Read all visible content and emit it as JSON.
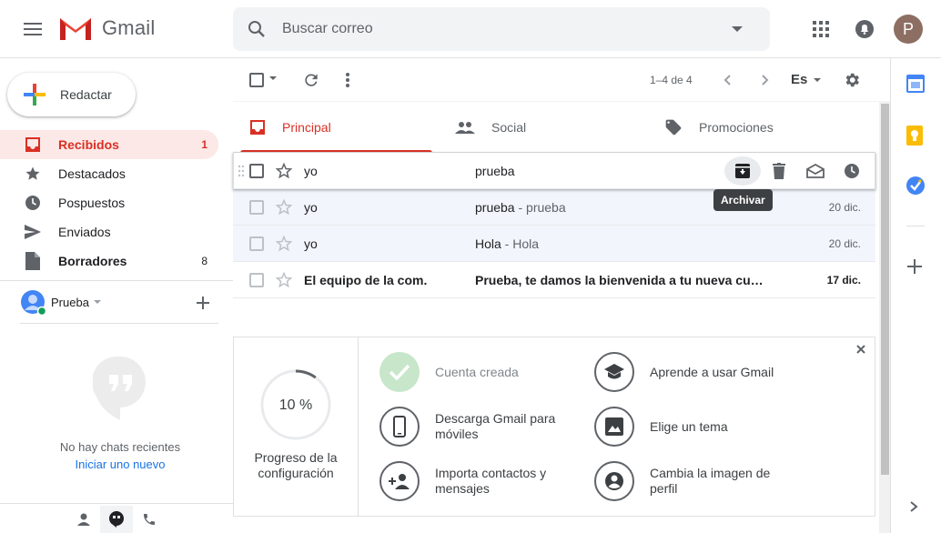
{
  "header": {
    "app_name": "Gmail",
    "search_placeholder": "Buscar correo",
    "avatar_letter": "P"
  },
  "sidebar": {
    "compose_label": "Redactar",
    "items": [
      {
        "label": "Recibidos",
        "count": "1",
        "icon": "inbox-icon",
        "active": true
      },
      {
        "label": "Destacados",
        "count": "",
        "icon": "star-icon"
      },
      {
        "label": "Pospuestos",
        "count": "",
        "icon": "clock-icon"
      },
      {
        "label": "Enviados",
        "count": "",
        "icon": "send-icon"
      },
      {
        "label": "Borradores",
        "count": "8",
        "icon": "draft-icon",
        "bold": true
      }
    ],
    "hangouts": {
      "user_name": "Prueba",
      "no_chats": "No hay chats recientes",
      "start_chat": "Iniciar uno nuevo"
    }
  },
  "toolbar": {
    "page_range": "1–4 de 4",
    "language": "Es"
  },
  "tabs": [
    {
      "label": "Principal",
      "icon": "inbox-icon",
      "active": true
    },
    {
      "label": "Social",
      "icon": "people-icon"
    },
    {
      "label": "Promociones",
      "icon": "tag-icon"
    }
  ],
  "emails": [
    {
      "sender": "yo",
      "subject": "prueba",
      "snippet": "",
      "date": "",
      "unread": false,
      "hover": true
    },
    {
      "sender": "yo",
      "subject": "prueba",
      "snippet": " - prueba",
      "date": "20 dic.",
      "unread": false
    },
    {
      "sender": "yo",
      "subject": "Hola",
      "snippet": " - Hola",
      "date": "20 dic.",
      "unread": false
    },
    {
      "sender": "El equipo de la com.",
      "subject": "Prueba, te damos la bienvenida a tu nueva cuenta",
      "snippet": "",
      "date": "17 dic.",
      "unread": true
    }
  ],
  "row_actions": {
    "tooltip": "Archivar",
    "icons": [
      "archive-icon",
      "trash-icon",
      "mark-read-icon",
      "snooze-icon"
    ]
  },
  "setup": {
    "progress_text": "10 %",
    "progress_fraction": 0.1,
    "progress_label": "Progreso de la configuración",
    "items": [
      {
        "label": "Cuenta creada",
        "icon": "check-icon",
        "done": true
      },
      {
        "label": "Aprende a usar Gmail",
        "icon": "school-icon"
      },
      {
        "label": "Descarga Gmail para móviles",
        "icon": "phone-icon"
      },
      {
        "label": "Elige un tema",
        "icon": "image-icon"
      },
      {
        "label": "Importa contactos y mensajes",
        "icon": "person-add-icon"
      },
      {
        "label": "Cambia la imagen de perfil",
        "icon": "account-circle-icon"
      }
    ]
  },
  "colors": {
    "accent": "#d93025",
    "active_bg": "#fce8e6",
    "link": "#1a73e8"
  }
}
